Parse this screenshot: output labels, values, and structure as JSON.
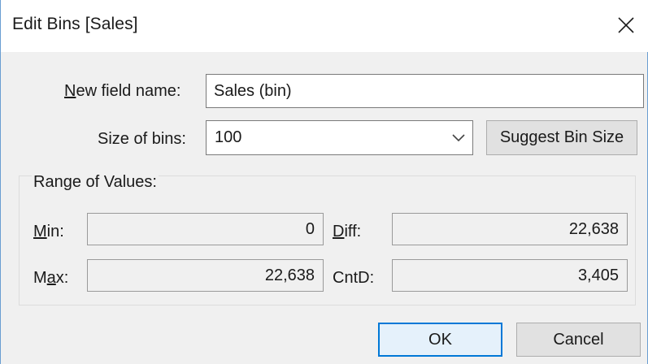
{
  "dialog": {
    "title": "Edit Bins [Sales]",
    "close_icon": "close-icon"
  },
  "new_field": {
    "label_underlined": "N",
    "label_rest": "ew field name:",
    "value": "Sales (bin)"
  },
  "bin_size": {
    "label": "Size of bins:",
    "value": "100",
    "dropdown_icon": "chevron-down-icon",
    "suggest_label": "Suggest Bin Size"
  },
  "range": {
    "title": "Range of Values:",
    "min_label_underlined": "M",
    "min_label_rest": "in:",
    "min_value": "0",
    "diff_label_underlined": "D",
    "diff_label_rest": "iff:",
    "diff_value": "22,638",
    "max_label_pre": "M",
    "max_label_underlined": "a",
    "max_label_rest": "x:",
    "max_value": "22,638",
    "cntd_label": "CntD:",
    "cntd_value": "3,405"
  },
  "buttons": {
    "ok": "OK",
    "cancel": "Cancel"
  }
}
